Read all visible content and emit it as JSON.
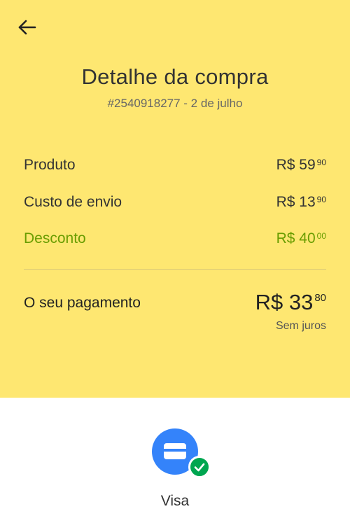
{
  "header": {
    "back_icon": "arrow-left-icon",
    "title": "Detalhe da compra",
    "subtitle": "#2540918277 - 2 de julho"
  },
  "summary": {
    "rows": [
      {
        "label": "Produto",
        "currency": "R$",
        "whole": "59",
        "cents": "90",
        "color": "#333333"
      },
      {
        "label": "Custo de envio",
        "currency": "R$",
        "whole": "13",
        "cents": "90",
        "color": "#333333"
      },
      {
        "label": "Desconto",
        "currency": "R$",
        "whole": "40",
        "cents": "00",
        "color": "#6a9d00"
      }
    ],
    "payment": {
      "label": "O seu pagamento",
      "currency": "R$",
      "whole": "33",
      "cents": "80",
      "note": "Sem juros"
    }
  },
  "payment_method": {
    "icon": "credit-card-icon",
    "status_icon": "check-icon",
    "label": "Visa"
  },
  "colors": {
    "header_bg": "#fee771",
    "discount": "#6a9d00",
    "card_icon_bg": "#3483fa",
    "check_bg": "#00a650"
  }
}
